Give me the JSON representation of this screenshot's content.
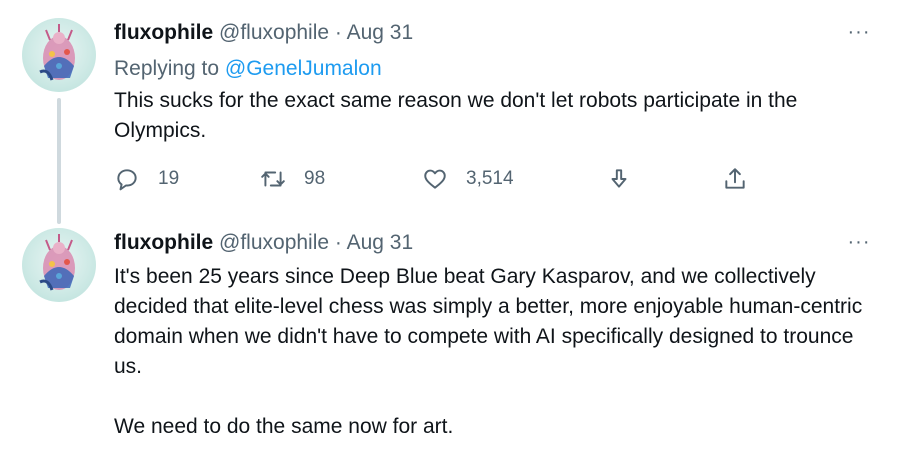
{
  "tweets": [
    {
      "display_name": "fluxophile",
      "handle": "@fluxophile",
      "separator": "·",
      "date": "Aug 31",
      "more_label": "···",
      "replying_prefix": "Replying to",
      "replying_to": "@GenelJumalon",
      "paragraphs": [
        "This sucks for the exact same reason we don't let robots participate in the Olympics."
      ],
      "actions": {
        "replies": "19",
        "retweets": "98",
        "likes": "3,514"
      }
    },
    {
      "display_name": "fluxophile",
      "handle": "@fluxophile",
      "separator": "·",
      "date": "Aug 31",
      "more_label": "···",
      "paragraphs": [
        "It's been 25 years since Deep Blue beat Gary Kasparov, and we collectively decided that elite-level chess was simply a better, more enjoyable human-centric domain when we didn't have to compete with AI specifically designed to trounce us.",
        "We need to do the same now for art."
      ]
    }
  ],
  "colors": {
    "text": "#0f1419",
    "secondary": "#536471",
    "link": "#1d9bf0",
    "thread_line": "#cfd9de"
  },
  "icons": {
    "reply": "speech-bubble-icon",
    "retweet": "retweet-arrows-icon",
    "like": "heart-icon",
    "bookmark": "download-arrow-icon",
    "share": "share-upload-icon",
    "more": "ellipsis-icon"
  }
}
